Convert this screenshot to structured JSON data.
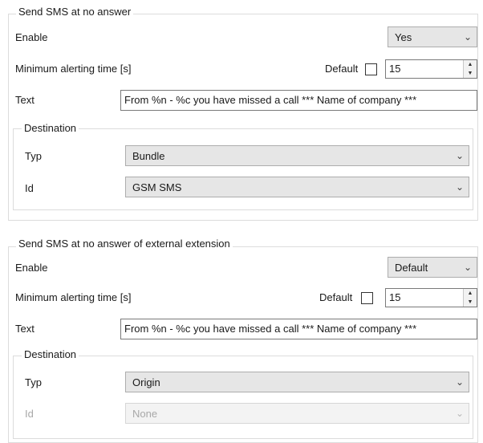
{
  "section1": {
    "title": "Send SMS at no answer",
    "enable_label": "Enable",
    "enable_value": "Yes",
    "min_alert_label": "Minimum alerting time [s]",
    "default_label": "Default",
    "default_checked": false,
    "min_alert_value": "15",
    "text_label": "Text",
    "text_value": "From %n - %c you have missed a call *** Name of company ***",
    "destination": {
      "title": "Destination",
      "typ_label": "Typ",
      "typ_value": "Bundle",
      "id_label": "Id",
      "id_value": "GSM SMS"
    }
  },
  "section2": {
    "title": "Send SMS at no answer of external extension",
    "enable_label": "Enable",
    "enable_value": "Default",
    "min_alert_label": "Minimum alerting time [s]",
    "default_label": "Default",
    "default_checked": false,
    "min_alert_value": "15",
    "text_label": "Text",
    "text_value": "From %n - %c you have missed a call *** Name of company ***",
    "destination": {
      "title": "Destination",
      "typ_label": "Typ",
      "typ_value": "Origin",
      "id_label": "Id",
      "id_value": "None"
    }
  },
  "icons": {
    "dropdown": "chevron-down-icon",
    "spin": "spin-updown-icon"
  }
}
